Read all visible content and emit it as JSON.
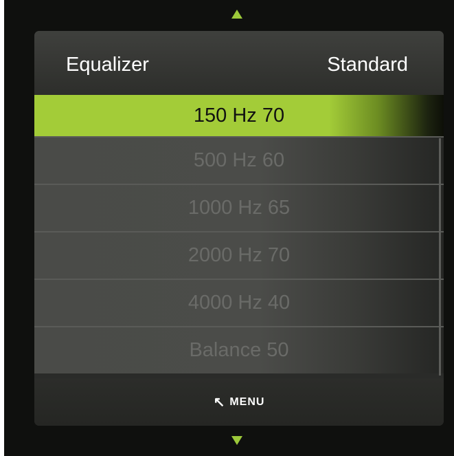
{
  "header": {
    "title": "Equalizer",
    "value": "Standard"
  },
  "selected": {
    "label": "150 Hz 70"
  },
  "items": [
    {
      "label": "500 Hz 60"
    },
    {
      "label": "1000 Hz 65"
    },
    {
      "label": "2000 Hz 70"
    },
    {
      "label": "4000 Hz 40"
    },
    {
      "label": "Balance 50"
    }
  ],
  "footer": {
    "back_icon": "↖",
    "menu_label": "MENU"
  },
  "colors": {
    "accent": "#9cc93a",
    "selected_bg": "#a3cc38",
    "background": "#0f100e"
  },
  "icons": {
    "scroll_up": "triangle-up-icon",
    "scroll_down": "triangle-down-icon",
    "back": "return-arrow-icon"
  }
}
